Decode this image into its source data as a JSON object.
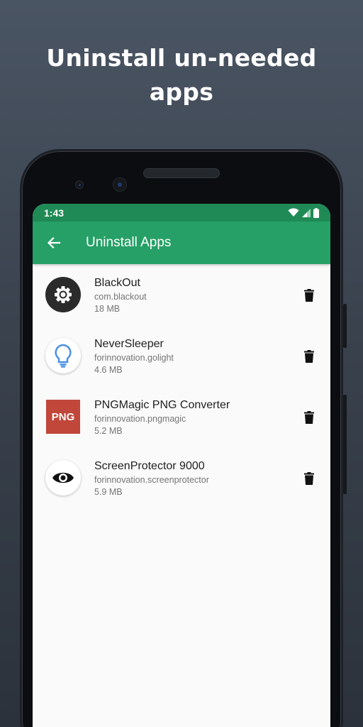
{
  "promo": {
    "line1": "Uninstall un-needed",
    "line2": "apps"
  },
  "statusbar": {
    "time": "1:43"
  },
  "appbar": {
    "title": "Uninstall Apps"
  },
  "apps": [
    {
      "name": "BlackOut",
      "package": "com.blackout",
      "size": "18 MB",
      "icon": "gear-icon"
    },
    {
      "name": "NeverSleeper",
      "package": "forinnovation.golight",
      "size": "4.6 MB",
      "icon": "lightbulb-icon"
    },
    {
      "name": "PNGMagic PNG Converter",
      "package": "forinnovation.pngmagic",
      "size": "5.2 MB",
      "icon": "png-icon",
      "icon_text": "PNG"
    },
    {
      "name": "ScreenProtector 9000",
      "package": "forinnovation.screenprotector",
      "size": "5.9 MB",
      "icon": "eye-icon"
    }
  ],
  "colors": {
    "status_bar": "#1f8a55",
    "app_bar": "#26a066",
    "png_icon": "#c0473a"
  }
}
